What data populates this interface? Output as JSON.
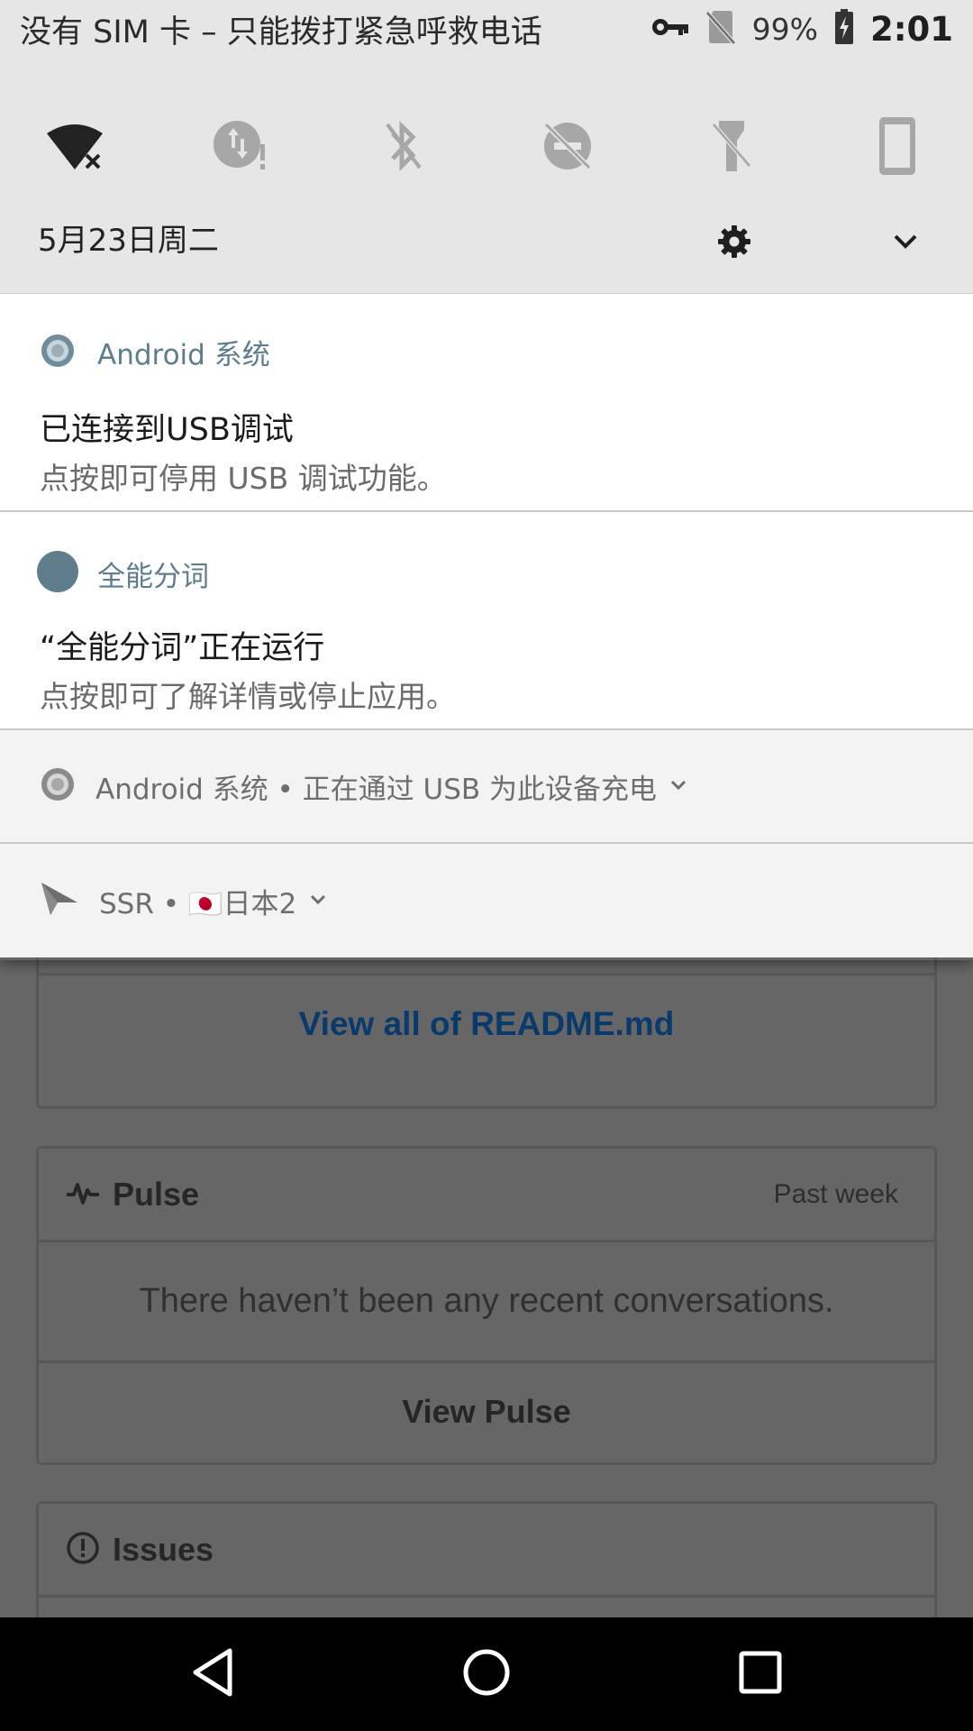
{
  "status_bar": {
    "carrier_text": "没有 SIM 卡 – 只能拨打紧急呼救电话",
    "battery_percent": "99%",
    "time": "2:01",
    "icons": [
      "vpn-key-icon",
      "no-sim-icon",
      "battery-charging-icon"
    ]
  },
  "quick_settings": {
    "tiles": [
      {
        "name": "wifi-off-tile",
        "icon": "wifi-disconnected-icon",
        "active": true
      },
      {
        "name": "mobile-data-tile",
        "icon": "data-alert-icon",
        "active": false
      },
      {
        "name": "bluetooth-tile",
        "icon": "bluetooth-off-icon",
        "active": false
      },
      {
        "name": "do-not-disturb-tile",
        "icon": "dnd-off-icon",
        "active": false
      },
      {
        "name": "flashlight-tile",
        "icon": "flashlight-off-icon",
        "active": false
      },
      {
        "name": "rotation-tile",
        "icon": "portrait-phone-icon",
        "active": false
      }
    ],
    "date": "5月23日周二"
  },
  "notifications": [
    {
      "app": "Android 系统",
      "title": "已连接到USB调试",
      "body": "点按即可停用 USB 调试功能。",
      "icon": "android-system-icon"
    },
    {
      "app": "全能分词",
      "title": "“全能分词”正在运行",
      "body": "点按即可了解详情或停止应用。",
      "icon": "app-circle-icon"
    }
  ],
  "minimized_notifications": [
    {
      "label": "Android 系统 • 正在通过 USB 为此设备充电",
      "icon": "android-system-icon"
    },
    {
      "label": "SSR • 🇯🇵日本2",
      "icon": "paper-plane-icon"
    }
  ],
  "background_page": {
    "readme_link": "View all of README.md",
    "pulse_title": "Pulse",
    "pulse_period": "Past week",
    "pulse_message": "There haven’t been any recent conversations.",
    "pulse_link": "View Pulse",
    "issues_title": "Issues"
  },
  "colors": {
    "shade_bg": "#e6e6e6",
    "notification_accent": "#5e7d8c",
    "scrim": "#646464"
  }
}
